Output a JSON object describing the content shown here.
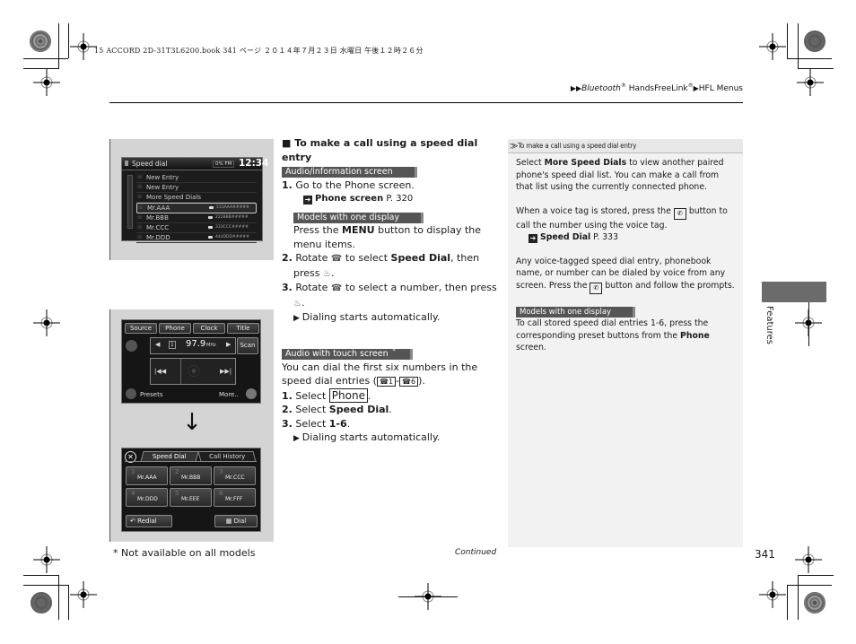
{
  "print_header": "15 ACCORD 2D-31T3L6200.book  341 ページ  ２０１４年７月２３日  水曜日  午後１２時２６分",
  "breadcrumb": {
    "items": [
      "Bluetooth",
      "HandsFreeLink",
      "HFL Menus"
    ],
    "marks": [
      "®",
      "®"
    ]
  },
  "screens": {
    "speed_dial_list": {
      "title": "Speed dial",
      "status": "0% FM",
      "clock": "12:34",
      "rows": [
        {
          "name": "New Entry",
          "number": ""
        },
        {
          "name": "New Entry",
          "number": ""
        },
        {
          "name": "More Speed Dials",
          "number": ""
        },
        {
          "name": "Mr.AAA",
          "number": "111AAA#####"
        },
        {
          "name": "Mr.BBB",
          "number": "222BBB#####"
        },
        {
          "name": "Mr.CCC",
          "number": "333CCC#####"
        },
        {
          "name": "Mr.DDD",
          "number": "444DDD#####"
        }
      ],
      "selected_index": 3
    },
    "audio_touch": {
      "tabs": [
        "Source",
        "Phone",
        "Clock",
        "Title"
      ],
      "preset": "1",
      "frequency": "97.9",
      "unit": "MHz",
      "scan": "Scan",
      "presets": "Presets",
      "more": "More.."
    },
    "arrow": "↓",
    "speed_dial_touch": {
      "tabs": [
        "Speed Dial",
        "Call History"
      ],
      "entries": [
        {
          "n": "1",
          "name": "Mr.AAA"
        },
        {
          "n": "2",
          "name": "Mr.BBB"
        },
        {
          "n": "3",
          "name": "Mr.CCC"
        },
        {
          "n": "4",
          "name": "Mr.DDD"
        },
        {
          "n": "5",
          "name": "Mr.EEE"
        },
        {
          "n": "6",
          "name": "Mr.FFF"
        }
      ],
      "redial": "Redial",
      "dial": "Dial"
    }
  },
  "main": {
    "heading": "To make a call using a speed dial entry",
    "label_audio_info": "Audio/information screen",
    "step1": {
      "num": "1.",
      "text": "Go to the Phone screen."
    },
    "xref1": {
      "bold": "Phone screen",
      "page": " P. 320"
    },
    "label_one_display": "Models with one display",
    "press_menu": {
      "pre": "Press the ",
      "bold": "MENU",
      "post": " button to display the menu items."
    },
    "step2": {
      "num": "2.",
      "pre": "Rotate ",
      "mid": " to select ",
      "bold": "Speed Dial",
      "post": ", then press ",
      "end": "."
    },
    "step3": {
      "num": "3.",
      "pre": "Rotate ",
      "mid": " to select a number, then press ",
      "end": "."
    },
    "result1": "Dialing starts automatically.",
    "label_touch": "Audio with touch screen",
    "touch_intro": {
      "pre": "You can dial the first six numbers in the speed dial entries (",
      "icon1": "1",
      "icon2": "6",
      "post": ")."
    },
    "t_step1": {
      "num": "1.",
      "pre": "Select ",
      "boxed": "Phone",
      "post": "."
    },
    "t_step2": {
      "num": "2.",
      "pre": "Select ",
      "bold": "Speed Dial",
      "post": "."
    },
    "t_step3": {
      "num": "3.",
      "pre": "Select ",
      "bold": "1-6",
      "post": "."
    },
    "result2": "Dialing starts automatically."
  },
  "sidebar": {
    "head": "To make a call using a speed dial entry",
    "p1": {
      "pre": "Select ",
      "bold": "More Speed Dials",
      "post": " to view another paired phone's speed dial list. You can make a call from that list using the currently connected phone."
    },
    "p2": {
      "pre": "When a voice tag is stored, press the ",
      "post": " button to call the number using the voice tag."
    },
    "xref": {
      "bold": "Speed Dial",
      "page": " P. 333"
    },
    "p3": {
      "pre": "Any voice-tagged speed dial entry, phonebook name, or number can be dialed by voice from any screen. Press the ",
      "post": " button and follow the prompts."
    },
    "label_one_display": "Models with one display",
    "p4": {
      "pre": "To call stored speed dial entries 1-6, press the corresponding preset buttons from the ",
      "bold": "Phone",
      "post": " screen."
    }
  },
  "side_tab": {
    "label": "Features"
  },
  "footer": {
    "footnote": "* Not available on all models",
    "continued": "Continued",
    "page_number": "341"
  }
}
